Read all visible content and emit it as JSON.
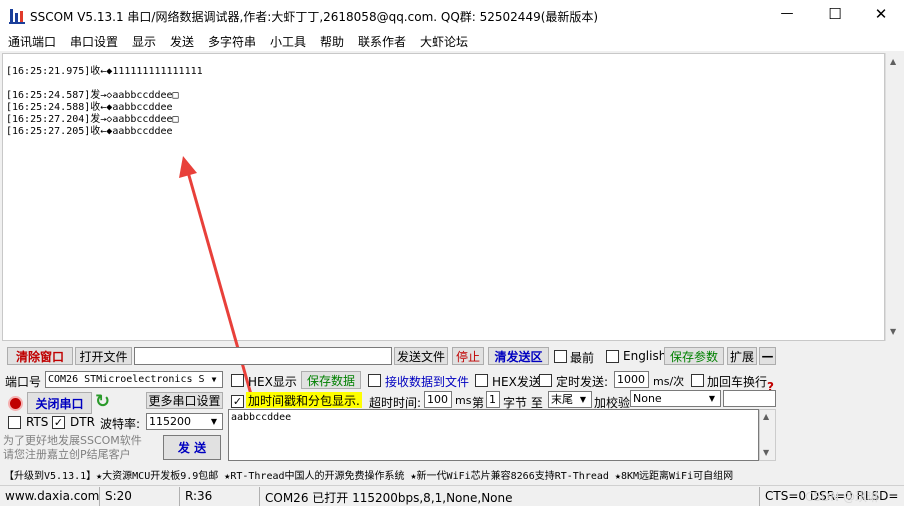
{
  "title_bar": {
    "title": "SSCOM V5.13.1 串口/网络数据调试器,作者:大虾丁丁,2618058@qq.com. QQ群: 52502449(最新版本)",
    "minimize": "—",
    "maximize": "☐",
    "close": "✕"
  },
  "menu": [
    "通讯端口",
    "串口设置",
    "显示",
    "发送",
    "多字符串",
    "小工具",
    "帮助",
    "联系作者",
    "大虾论坛"
  ],
  "log": [
    "[16:25:21.975]收←◆111111111111111",
    "",
    "[16:25:24.587]发→◇aabbccddee□",
    "[16:25:24.588]收←◆aabbccddee",
    "[16:25:27.204]发→◇aabbccddee□",
    "[16:25:27.205]收←◆aabbccddee"
  ],
  "toolbar": {
    "clear_window": "清除窗口",
    "open_file": "打开文件",
    "file_path": "",
    "send_file": "发送文件",
    "stop": "停止",
    "clear_send": "清发送区",
    "topmost": "最前",
    "english": "English",
    "save_params": "保存参数",
    "expand": "扩展",
    "collapse": "—"
  },
  "port": {
    "label": "端口号",
    "value": "COM26 STMicroelectronics S",
    "close_port": "关闭串口",
    "more_settings": "更多串口设置",
    "rts": "RTS",
    "dtr": "DTR",
    "dtr_checked": "✓",
    "baud_label": "波特率:",
    "baud_value": "115200",
    "promo": "为了更好地发展SSCOM软件\n请您注册嘉立创P结尾客户",
    "send": "发 送"
  },
  "options": {
    "hex_display": "HEX显示",
    "save_data": "保存数据",
    "recv_to_file": "接收数据到文件",
    "hex_send": "HEX发送",
    "timed_send": "定时发送:",
    "interval": "1000",
    "interval_unit": "ms/次",
    "add_crlf": "加回车换行",
    "timestamp": "加时间戳和分包显示.",
    "timestamp_checked": "✓",
    "timeout_label": "超时时间:",
    "timeout": "100",
    "timeout_unit": "ms",
    "byte_prefix": "第",
    "byte_index": "1",
    "byte_suffix": "字节 至",
    "byte_end": "末尾",
    "checksum_label": "加校验",
    "checksum": "None",
    "help": "?"
  },
  "send_text": "aabbccddee",
  "ad_banner": "【升级到V5.13.1】★大资源MCU开发板9.9包邮 ★RT-Thread中国人的开源免费操作系统 ★新一代WiFi芯片兼容8266支持RT-Thread ★8KM远距离WiFi可自组网",
  "status": {
    "website": "www.daxia.com",
    "sent": "S:20",
    "received": "R:36",
    "port_state": "COM26 已打开  115200bps,8,1,None,None",
    "lines": "CTS=0 DSR=0 RLSD="
  },
  "watermark": "CSDN @琪琳",
  "colors": {
    "red_arrow": "#e8403a",
    "highlight": "#ffff00",
    "btn_text_green": "#008000",
    "btn_text_blue": "#0000c0",
    "btn_text_red": "#c00000"
  }
}
